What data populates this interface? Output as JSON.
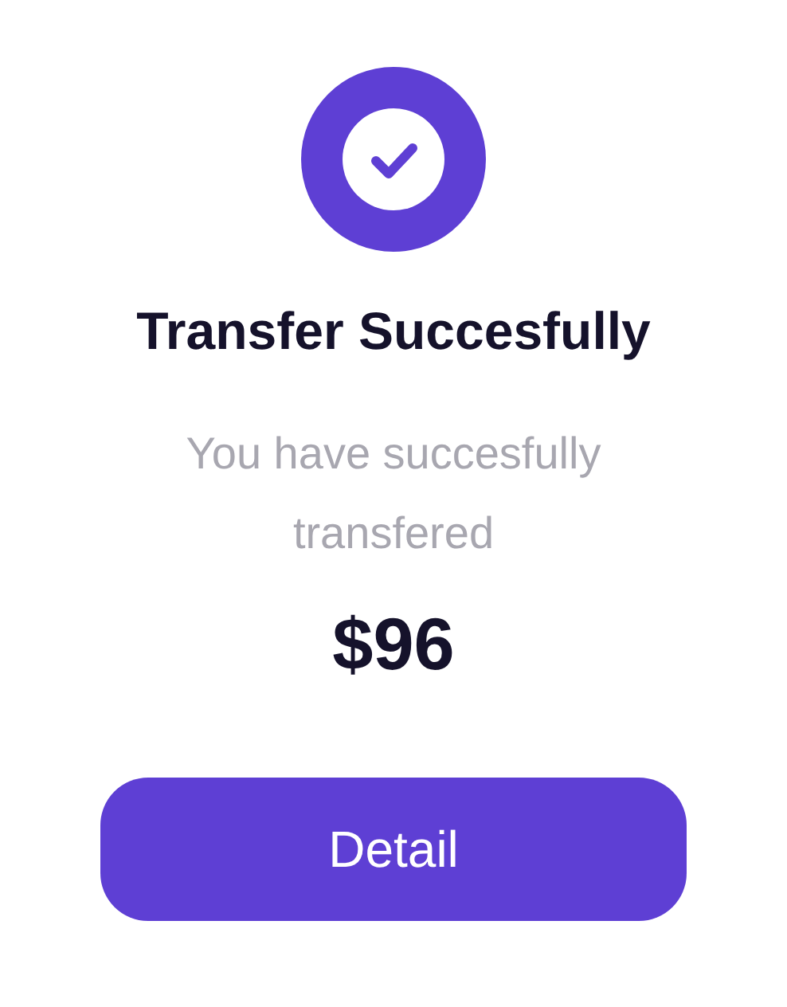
{
  "title": "Transfer Succesfully",
  "message": "You have succesfully transfered",
  "amount": "$96",
  "button": {
    "label": "Detail"
  }
}
